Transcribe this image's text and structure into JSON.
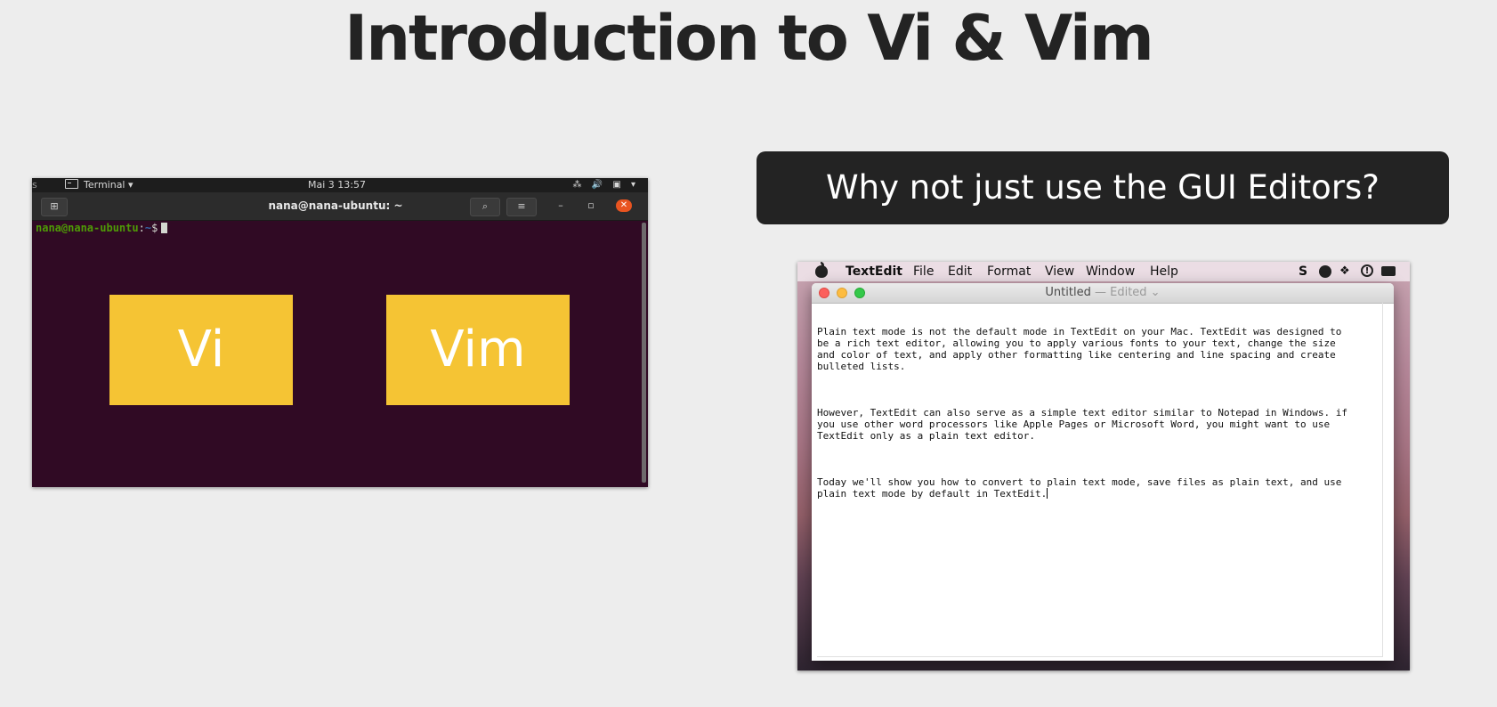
{
  "slide": {
    "title": "Introduction to Vi & Vim"
  },
  "terminal": {
    "topbar": {
      "activities": "s",
      "app_name": "Terminal ▾",
      "clock": "Mai 3  13:57",
      "system_tray": "⁂ 🔊 ▣ ▾"
    },
    "header": {
      "title": "nana@nana-ubuntu: ~",
      "minimize": "–",
      "maximize": "▫",
      "close": "✕"
    },
    "prompt": {
      "userhost": "nana@nana-ubuntu",
      "colon": ":",
      "path": "~",
      "symbol": "$"
    },
    "overlay_boxes": [
      "Vi",
      "Vim"
    ],
    "colors": {
      "background": "#300a24",
      "accent_box": "#f5c434",
      "close_button": "#e95420"
    }
  },
  "question": {
    "text": "Why not just use the GUI Editors?"
  },
  "textedit": {
    "menubar": {
      "app_name": "TextEdit",
      "menus": [
        "File",
        "Edit",
        "Format",
        "View",
        "Window",
        "Help"
      ],
      "status_items": [
        "S",
        "●",
        "❖",
        "!",
        "▬"
      ]
    },
    "window": {
      "doc_title": "Untitled",
      "separator": " — ",
      "doc_state": "Edited ⌄"
    },
    "paragraphs": [
      "Plain text mode is not the default mode in TextEdit on your Mac. TextEdit was designed to\nbe a rich text editor, allowing you to apply various fonts to your text, change the size\nand color of text, and apply other formatting like centering and line spacing and create\nbulleted lists.",
      "However, TextEdit can also serve as a simple text editor similar to Notepad in Windows. if\nyou use other word processors like Apple Pages or Microsoft Word, you might want to use\nTextEdit only as a plain text editor.",
      "Today we'll show you how to convert to plain text mode, save files as plain text, and use\nplain text mode by default in TextEdit."
    ]
  }
}
